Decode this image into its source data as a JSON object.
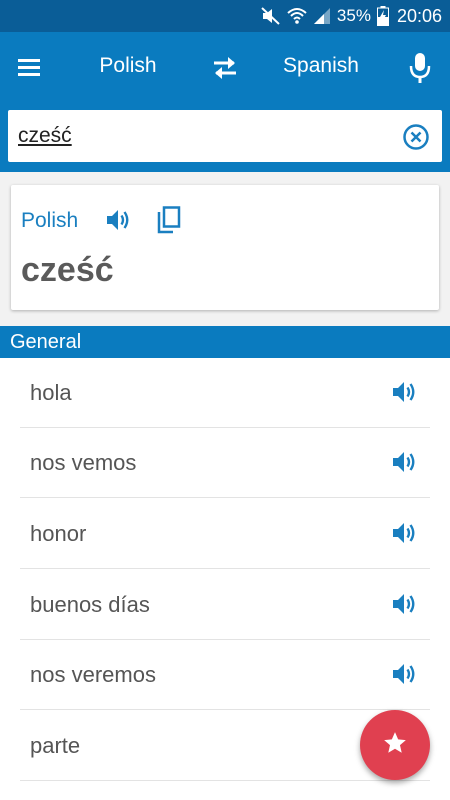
{
  "status_bar": {
    "icons": [
      "mute-icon",
      "wifi-icon",
      "signal-icon",
      "battery-charging-icon"
    ],
    "battery": "35%",
    "time": "20:06"
  },
  "toolbar": {
    "menu_icon": "hamburger-menu-icon",
    "source_language": "Polish",
    "swap_icon": "swap-languages-icon",
    "target_language": "Spanish",
    "mic_icon": "microphone-icon"
  },
  "search": {
    "value": "cześć",
    "clear_icon": "clear-circle-icon"
  },
  "word_card": {
    "language": "Polish",
    "word": "cześć",
    "speak_icon": "speaker-icon",
    "copy_icon": "copy-icon"
  },
  "section": {
    "title": "General"
  },
  "translations": [
    {
      "text": "hola"
    },
    {
      "text": "nos vemos"
    },
    {
      "text": "honor"
    },
    {
      "text": "buenos días"
    },
    {
      "text": "nos veremos"
    },
    {
      "text": "parte"
    }
  ],
  "fab": {
    "icon": "star-icon"
  },
  "colors": {
    "toolbar": "#0a7bbf",
    "status_bar": "#0a5d97",
    "accent_text": "#1a7fc0",
    "fab": "#e04050",
    "background": "#f2f2f2"
  }
}
